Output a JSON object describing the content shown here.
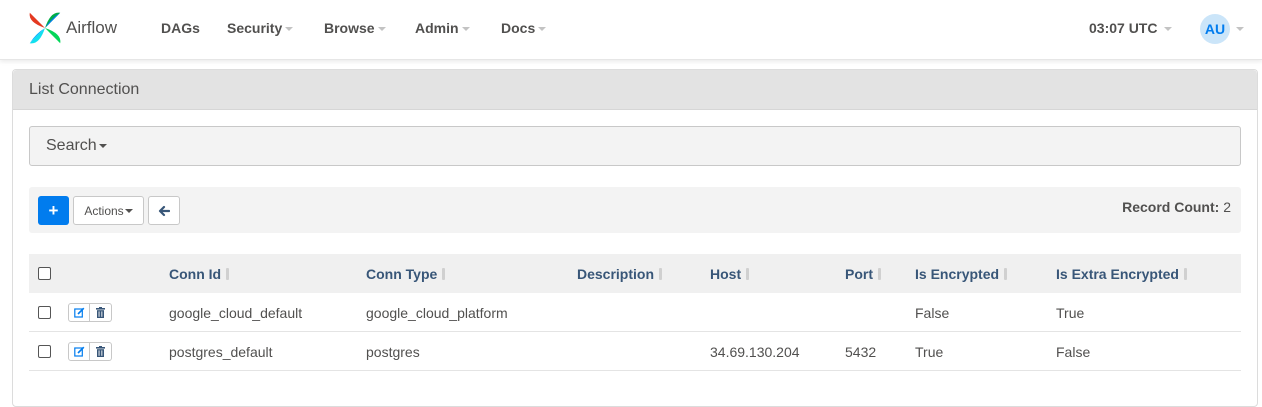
{
  "brand": {
    "name": "Airflow"
  },
  "nav": {
    "items": [
      {
        "label": "DAGs",
        "has_caret": false
      },
      {
        "label": "Security",
        "has_caret": true
      },
      {
        "label": "Browse",
        "has_caret": true
      },
      {
        "label": "Admin",
        "has_caret": true
      },
      {
        "label": "Docs",
        "has_caret": true
      }
    ],
    "clock": "03:07 UTC",
    "user_initials": "AU"
  },
  "panel": {
    "title": "List Connection",
    "search_label": "Search"
  },
  "toolbar": {
    "add_label": "+",
    "actions_label": "Actions",
    "record_count_label": "Record Count:",
    "record_count_value": "2"
  },
  "table": {
    "columns": [
      "Conn Id",
      "Conn Type",
      "Description",
      "Host",
      "Port",
      "Is Encrypted",
      "Is Extra Encrypted"
    ],
    "rows": [
      {
        "conn_id": "google_cloud_default",
        "conn_type": "google_cloud_platform",
        "description": "",
        "host": "",
        "port": "",
        "is_encrypted": "False",
        "is_extra_encrypted": "True"
      },
      {
        "conn_id": "postgres_default",
        "conn_type": "postgres",
        "description": "",
        "host": "34.69.130.204",
        "port": "5432",
        "is_encrypted": "True",
        "is_extra_encrypted": "False"
      }
    ]
  },
  "colors": {
    "primary": "#017cee",
    "header_link": "#385678",
    "text": "#51504f"
  }
}
